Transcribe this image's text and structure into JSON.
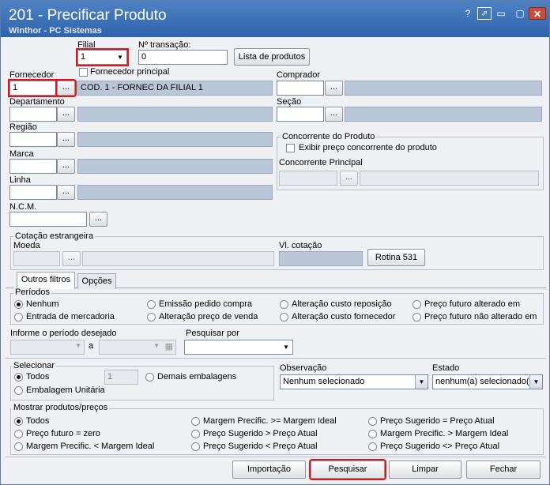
{
  "window": {
    "title": "201 - Precificar Produto",
    "subtitle": "Winthor - PC Sistemas",
    "help_btn": "?",
    "pin_btn": "⇗",
    "min_btn": "▭",
    "close_btn": "✕"
  },
  "filial": {
    "label": "Filial",
    "value": "1"
  },
  "transacao": {
    "label": "Nº transação:",
    "value": "0"
  },
  "lista_btn": "Lista de produtos",
  "fornecedor_principal": "Fornecedor principal",
  "fornecedor": {
    "label": "Fornecedor",
    "code": "1",
    "name": "COD. 1 - FORNEC DA FILIAL 1"
  },
  "comprador": {
    "label": "Comprador"
  },
  "departamento": {
    "label": "Departamento"
  },
  "secao": {
    "label": "Seção"
  },
  "regiao": {
    "label": "Região"
  },
  "marca": {
    "label": "Marca"
  },
  "linha": {
    "label": "Linha"
  },
  "ncm": {
    "label": "N.C.M."
  },
  "dots": "...",
  "concorrente": {
    "group": "Concorrente do Produto",
    "exibir": "Exibir preço concorrente do produto",
    "principal": "Concorrente Principal"
  },
  "cotacao": {
    "group": "Cotação estrangeira",
    "moeda": "Moeda",
    "vl": "Vl. cotação",
    "rotina_btn": "Rotina 531"
  },
  "tabs": [
    "Outros filtros",
    "Opções"
  ],
  "periodos": {
    "group": "Períodos",
    "options": [
      "Nenhum",
      "Emissão pedido compra",
      "Alteração custo reposição",
      "Preço futuro alterado em",
      "Entrada de mercadoria",
      "Alteração preço de venda",
      "Alteração custo fornecedor",
      "Preço futuro não alterado em"
    ]
  },
  "informe": {
    "label": "Informe o período desejado",
    "a": "a"
  },
  "pesquisar_por": {
    "label": "Pesquisar por",
    "value": ""
  },
  "selecionar": {
    "group": "Selecionar",
    "todos": "Todos",
    "qtd": "1",
    "demais": "Demais embalagens",
    "unitaria": "Embalagem Unitária"
  },
  "observacao": {
    "label": "Observação",
    "value": "Nenhum selecionado"
  },
  "estado": {
    "label": "Estado",
    "value": "nenhum(a) selecionado(a)"
  },
  "mostrar": {
    "group": "Mostrar produtos/preços",
    "options": [
      "Todos",
      "Margem Precific. >= Margem Ideal",
      "Preço Sugerido = Preço Atual",
      "Preço futuro = zero",
      "Preço Sugerido > Preço Atual",
      "Margem Precific. > Margem Ideal",
      "Margem Precific. < Margem Ideal",
      "Preço Sugerido < Preço Atual",
      "Preço Sugerido <> Preço Atual"
    ]
  },
  "footer": {
    "importacao": "Importação",
    "pesquisar": "Pesquisar",
    "limpar": "Limpar",
    "fechar": "Fechar"
  }
}
